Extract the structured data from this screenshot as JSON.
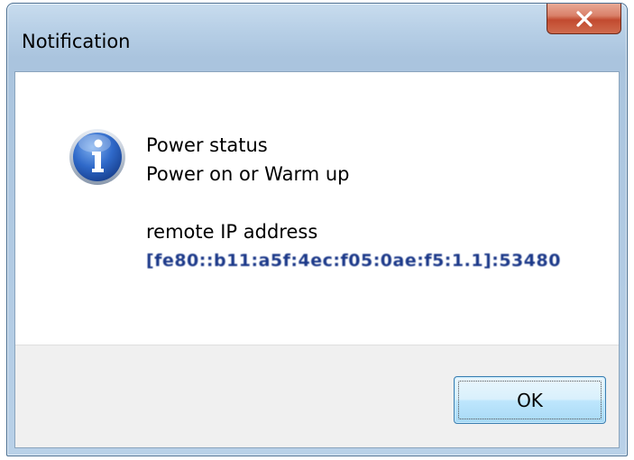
{
  "window": {
    "title": "Notification",
    "close_icon": "close-icon"
  },
  "message": {
    "icon": "info-icon",
    "line1": "Power status",
    "line2": "Power on or Warm up",
    "line3": "remote IP address",
    "line4": "[fe80::b11:a5f:4ec:f05:0ae:f5:1.1]:53480"
  },
  "buttons": {
    "ok_label": "OK"
  },
  "colors": {
    "titlebar": "#b9d1e8",
    "close_button": "#c24a2f",
    "ok_button_border": "#3c7fb1",
    "footer": "#f0f0f0"
  }
}
